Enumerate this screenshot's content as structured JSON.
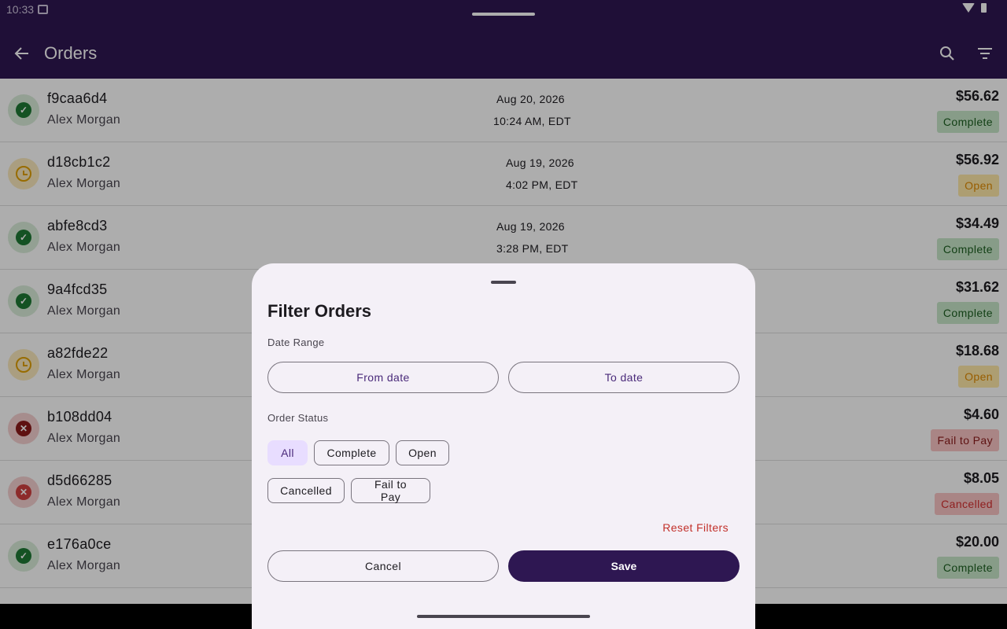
{
  "status_bar": {
    "time": "10:33"
  },
  "app_bar": {
    "title": "Orders"
  },
  "orders": [
    {
      "id": "f9caa6d4",
      "customer": "Alex Morgan",
      "date": "Aug 20, 2026",
      "time": "10:24 AM, EDT",
      "amount": "$56.62",
      "status": "Complete",
      "icon": "check-icon"
    },
    {
      "id": "d18cb1c2",
      "customer": "Alex Morgan",
      "date": "Aug 19, 2026",
      "time": "4:02 PM, EDT",
      "amount": "$56.92",
      "status": "Open",
      "icon": "clock-icon"
    },
    {
      "id": "abfe8cd3",
      "customer": "Alex Morgan",
      "date": "Aug 19, 2026",
      "time": "3:28 PM, EDT",
      "amount": "$34.49",
      "status": "Complete",
      "icon": "check-icon"
    },
    {
      "id": "9a4fcd35",
      "customer": "Alex Morgan",
      "date": "",
      "time": "",
      "amount": "$31.62",
      "status": "Complete",
      "icon": "check-icon"
    },
    {
      "id": "a82fde22",
      "customer": "Alex Morgan",
      "date": "",
      "time": "",
      "amount": "$18.68",
      "status": "Open",
      "icon": "clock-icon"
    },
    {
      "id": "b108dd04",
      "customer": "Alex Morgan",
      "date": "",
      "time": "",
      "amount": "$4.60",
      "status": "Fail to Pay",
      "icon": "x-icon"
    },
    {
      "id": "d5d66285",
      "customer": "Alex Morgan",
      "date": "",
      "time": "",
      "amount": "$8.05",
      "status": "Cancelled",
      "icon": "x-icon"
    },
    {
      "id": "e176a0ce",
      "customer": "Alex Morgan",
      "date": "",
      "time": "",
      "amount": "$20.00",
      "status": "Complete",
      "icon": "check-icon"
    }
  ],
  "filter_sheet": {
    "title": "Filter Orders",
    "date_range_label": "Date Range",
    "from_date": "From date",
    "to_date": "To date",
    "order_status_label": "Order Status",
    "chips": [
      "All",
      "Complete",
      "Open",
      "Cancelled",
      "Fail to Pay"
    ],
    "selected_chip": "All",
    "reset": "Reset Filters",
    "cancel": "Cancel",
    "save": "Save"
  },
  "colors": {
    "app_bar": "#2e1752",
    "complete_bg": "#c8e6c9",
    "complete_fg": "#1b5e20",
    "open_bg": "#ffe9a8",
    "open_fg": "#e08a00",
    "fail_bg": "#f9c4c4",
    "fail_fg": "#8b1a1a",
    "cancel_bg": "#f9c4c4",
    "cancel_fg": "#d32f2f"
  }
}
